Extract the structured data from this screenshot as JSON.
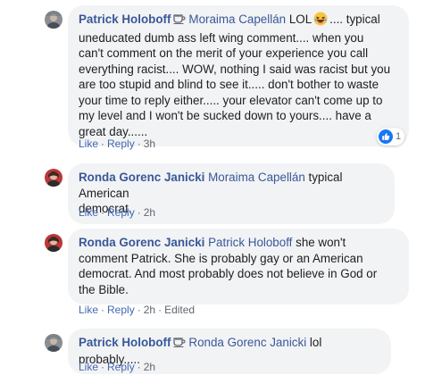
{
  "comments": [
    {
      "author": "Patrick Holoboff",
      "has_badge": true,
      "mention": "Moraima Capellán",
      "text_before_emoji": "LOL",
      "emoji": "laughing-emoji",
      "text_lines": [
        ".... typical",
        "uneducated dumb ass left wing comment.... when you",
        "can't comment on the merit of your experience you call",
        "everything racist.... WOW, nothing I said was racist but you",
        "are too stupid and blind to see it..... don't bother to waste",
        "your time to reply either..... your elevator can't come up to",
        "my level and I won't be sucked down to yours.... have a",
        "great day......"
      ],
      "like": "Like",
      "reply": "Reply",
      "time": "3h",
      "reaction_count": "1"
    },
    {
      "author": "Ronda Gorenc Janicki",
      "mention": "Moraima Capellán",
      "text_lines": [
        " typical American",
        "democrat."
      ],
      "like": "Like",
      "reply": "Reply",
      "time": "2h"
    },
    {
      "author": "Ronda Gorenc Janicki",
      "mention": "Patrick Holoboff",
      "text_lines": [
        " she won't",
        "comment Patrick. She is probably gay or an American",
        "democrat. And most probably does not believe in God or",
        "the Bible."
      ],
      "like": "Like",
      "reply": "Reply",
      "time": "2h",
      "edited": "Edited"
    },
    {
      "author": "Patrick Holoboff",
      "has_badge": true,
      "mention": "Ronda Gorenc Janicki",
      "text_lines": [
        " lol probably....."
      ],
      "like": "Like",
      "reply": "Reply",
      "time": "2h"
    }
  ],
  "colors": {
    "name_link": "#385898",
    "action_link": "#4267b2",
    "bubble_bg": "#f2f3f5",
    "meta_text": "#606770",
    "like_reaction": "#1877f2"
  },
  "separator": "·"
}
